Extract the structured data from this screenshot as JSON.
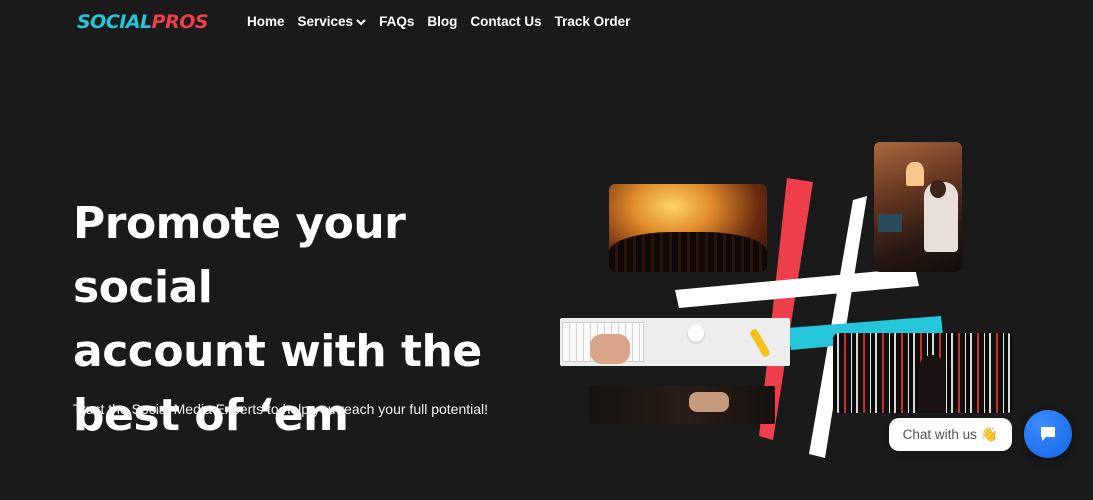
{
  "brand": {
    "part1": "SOCIAL",
    "part2": "PROS"
  },
  "nav": {
    "items": [
      {
        "label": "Home"
      },
      {
        "label": "Services"
      },
      {
        "label": "FAQs"
      },
      {
        "label": "Blog"
      },
      {
        "label": "Contact Us"
      },
      {
        "label": "Track Order"
      }
    ]
  },
  "hero": {
    "title_line1": "Promote your social",
    "title_line2": "account with the",
    "title_line3": "best of ‘em",
    "subtitle": "Trust the Social Media Experts to help you reach your full potential!"
  },
  "chat": {
    "label": "Chat with us",
    "emoji": "👋"
  },
  "colors": {
    "accent_cyan": "#26c6da",
    "accent_red": "#ef3f4a",
    "chat_blue": "#1a6cf0",
    "background": "#1b1a1b"
  }
}
